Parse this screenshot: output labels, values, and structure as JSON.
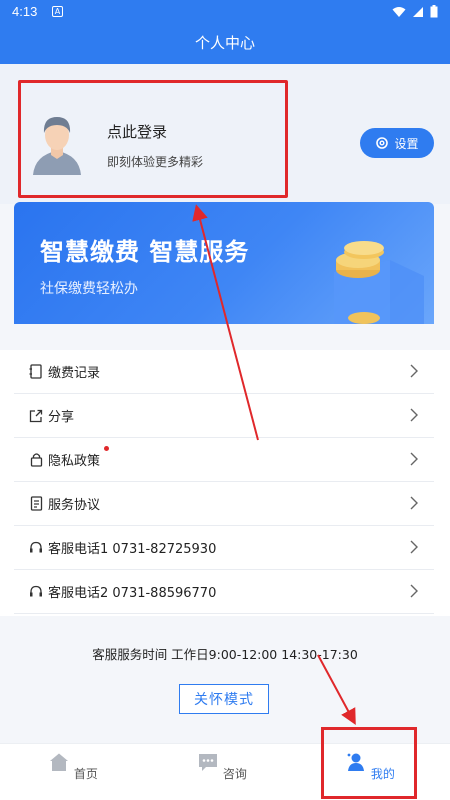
{
  "status": {
    "time": "4:13",
    "notif_letter": "A"
  },
  "header": {
    "title": "个人中心"
  },
  "profile": {
    "login_title": "点此登录",
    "login_subtitle": "即刻体验更多精彩",
    "settings_label": "设置"
  },
  "banner": {
    "title": "智慧缴费  智慧服务",
    "subtitle": "社保缴费轻松办"
  },
  "menu": {
    "items": [
      {
        "label": "缴费记录",
        "icon": "record-icon"
      },
      {
        "label": "分享",
        "icon": "share-icon"
      },
      {
        "label": "隐私政策",
        "icon": "lock-icon"
      },
      {
        "label": "服务协议",
        "icon": "document-icon"
      },
      {
        "label": "客服电话1 0731-82725930",
        "icon": "headset-icon"
      },
      {
        "label": "客服电话2 0731-88596770",
        "icon": "headset-icon"
      }
    ]
  },
  "footer": {
    "service_hours": "客服服务时间 工作日9:00-12:00 14:30-17:30",
    "care_mode": "关怀模式"
  },
  "tabs": [
    {
      "label": "首页",
      "icon": "home-icon"
    },
    {
      "label": "咨询",
      "icon": "chat-icon"
    },
    {
      "label": "我的",
      "icon": "user-icon"
    }
  ],
  "colors": {
    "primary": "#2f7cf0",
    "annotation_red": "#e0282b"
  }
}
